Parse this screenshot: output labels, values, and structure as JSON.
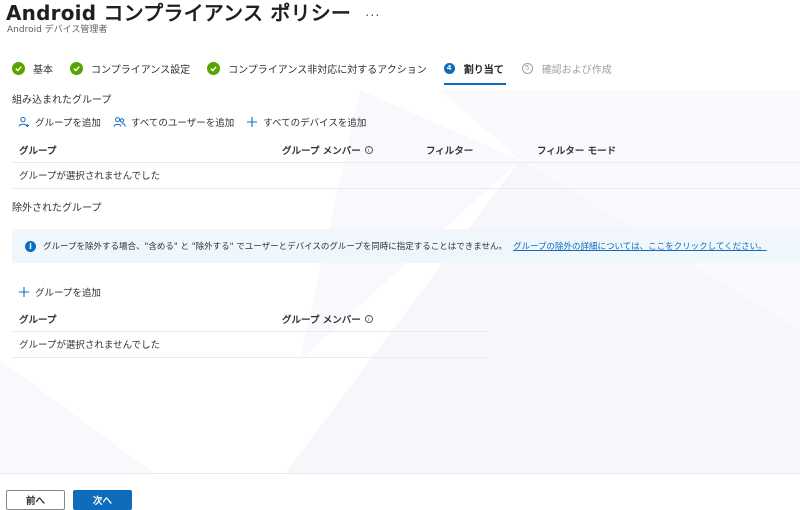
{
  "header": {
    "title": "Android コンプライアンス ポリシー",
    "more": "...",
    "subtitle": "Android デバイス管理者"
  },
  "wizard": {
    "steps": [
      {
        "label": "基本",
        "state": "done"
      },
      {
        "label": "コンプライアンス設定",
        "state": "done"
      },
      {
        "label": "コンプライアンス非対応に対するアクション",
        "state": "done"
      },
      {
        "label": "割り当て",
        "state": "active",
        "number": "4"
      },
      {
        "label": "確認および作成",
        "state": "pending",
        "number": "5"
      }
    ]
  },
  "included": {
    "title": "組み込まれたグループ",
    "commands": {
      "add_group": "グループを追加",
      "add_all_users": "すべてのユーザーを追加",
      "add_all_devices": "すべてのデバイスを追加"
    },
    "columns": {
      "group": "グループ",
      "members": "グループ メンバー",
      "filter": "フィルター",
      "filter_mode": "フィルター モード"
    },
    "empty": "グループが選択されませんでした"
  },
  "excluded": {
    "title": "除外されたグループ",
    "info_message": "グループを除外する場合、\"含める\" と \"除外する\" でユーザーとデバイスのグループを同時に指定することはできません。",
    "info_link": "グループの除外の詳細については、ここをクリックしてください。",
    "add_group": "グループを追加",
    "columns": {
      "group": "グループ",
      "members": "グループ メンバー"
    },
    "empty": "グループが選択されませんでした"
  },
  "footer": {
    "prev": "前へ",
    "next": "次へ"
  },
  "colors": {
    "accent": "#0f6cbd",
    "success": "#57a300",
    "info_bg": "#eff6fc"
  },
  "icons": {
    "info": "i"
  }
}
